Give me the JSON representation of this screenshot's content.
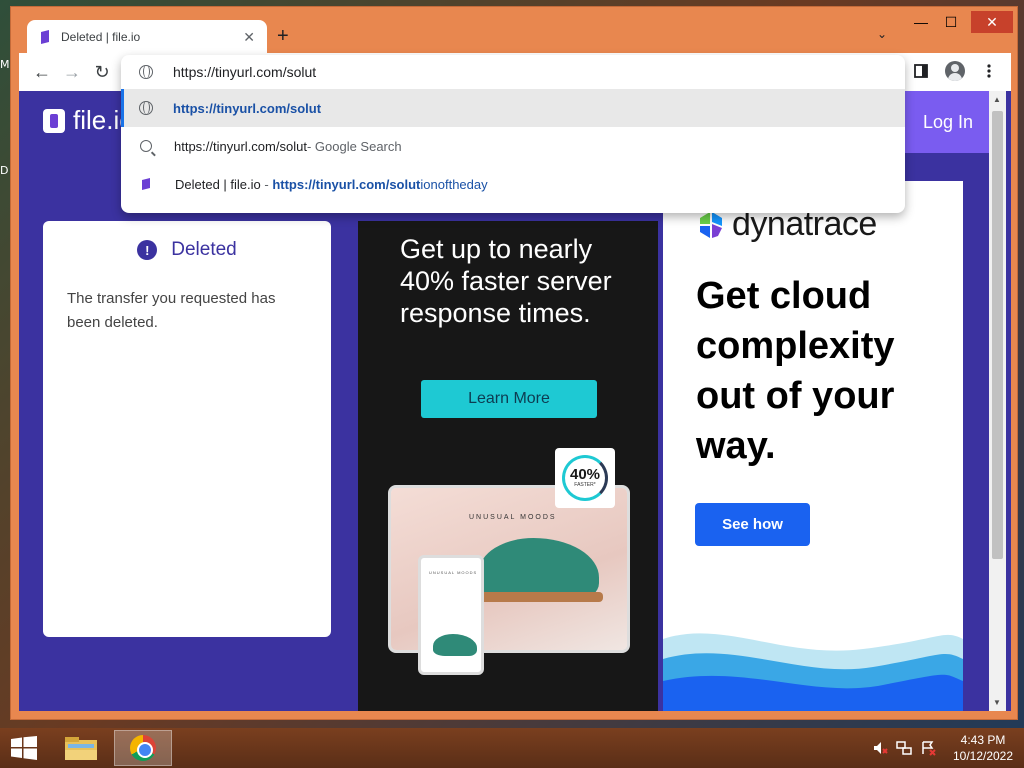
{
  "desktop": {
    "frag_top": "M",
    "frag_mid": "D"
  },
  "browser": {
    "tab": {
      "title": "Deleted | file.io",
      "close": "✕"
    },
    "new_tab": "+",
    "tab_list": "⌄",
    "window_controls": {
      "minimize": "—",
      "maximize": "☐",
      "close": "✕"
    },
    "nav": {
      "back": "←",
      "forward": "→",
      "reload": "↻"
    },
    "omnibox": {
      "value": "https://tinyurl.com/solut",
      "suggestions": [
        {
          "bold": "https://tinyurl.com/solut"
        },
        {
          "text": "https://tinyurl.com/solut",
          "suffix": " - Google Search"
        },
        {
          "title": "Deleted | file.io",
          "sep": " - ",
          "url_bold": "https://tinyurl.com/solut",
          "url_rest": "ionoftheday"
        }
      ]
    }
  },
  "page": {
    "logo_text": "file.io",
    "login": "Log In",
    "card": {
      "alert": "!",
      "title": "Deleted",
      "message": "The transfer you requested has been deleted."
    },
    "ad_mid": {
      "headline": "Get up to nearly 40% faster server response times.",
      "button": "Learn More",
      "brand": "UNUSUAL MOODS",
      "phone_brand": "UNUSUAL MOODS",
      "badge_num": "40%",
      "badge_sub": "FASTER*"
    },
    "ad_right": {
      "brand": "dynatrace",
      "headline": "Get cloud complexity out of your way.",
      "button": "See how"
    }
  },
  "taskbar": {
    "time": "4:43 PM",
    "date": "10/12/2022"
  },
  "colors": {
    "page_bg": "#3b32a0",
    "login_bg": "#7a5cf0",
    "cta_teal": "#1ec9d3",
    "cta_blue": "#1a62f0",
    "window_frame": "#e8874f"
  }
}
